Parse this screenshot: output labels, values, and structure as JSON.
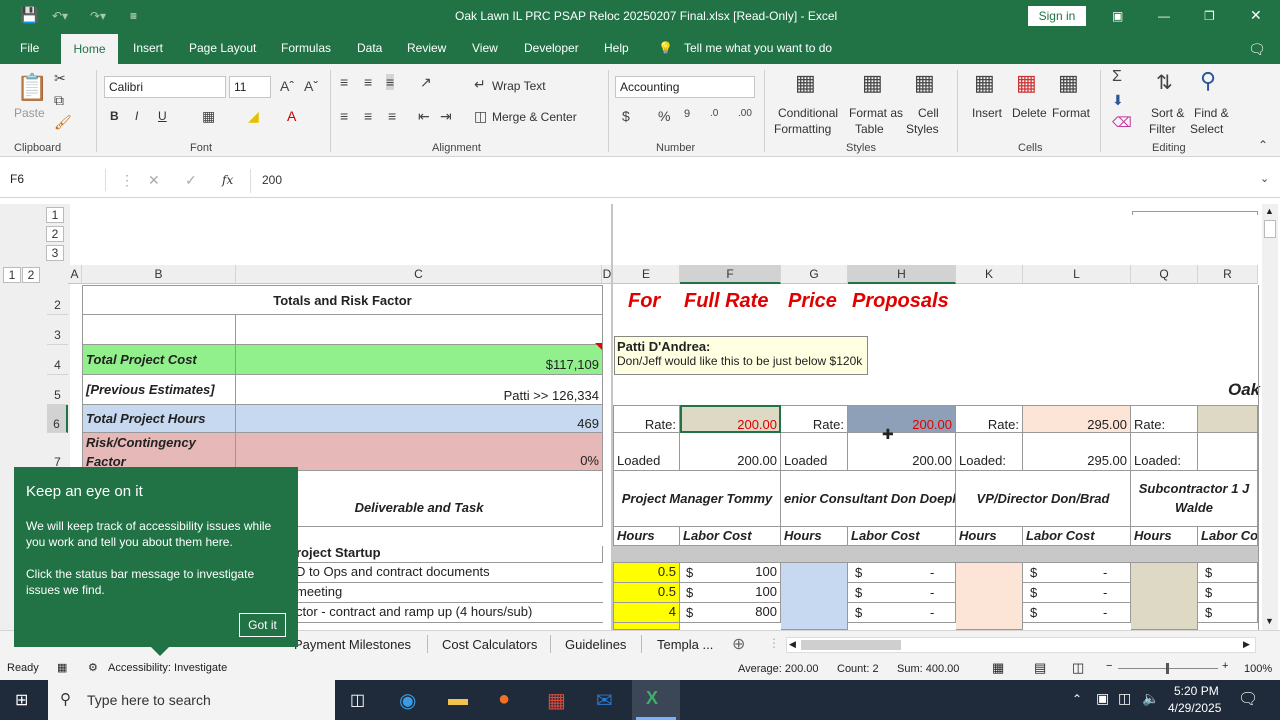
{
  "window": {
    "title": "Oak Lawn IL PRC PSAP Reloc 20250207 Final.xlsx  [Read-Only]  -  Excel",
    "signin": "Sign in"
  },
  "menu": {
    "file": "File",
    "home": "Home",
    "insert": "Insert",
    "page_layout": "Page Layout",
    "formulas": "Formulas",
    "data": "Data",
    "review": "Review",
    "view": "View",
    "developer": "Developer",
    "help": "Help",
    "tell": "Tell me what you want to do"
  },
  "ribbon": {
    "paste": "Paste",
    "clipboard": "Clipboard",
    "font_name": "Calibri",
    "font_size": "11",
    "font": "Font",
    "wrap": "Wrap Text",
    "merge": "Merge & Center",
    "alignment": "Alignment",
    "number_format": "Accounting",
    "number": "Number",
    "conditional": "Conditional",
    "formatting": "Formatting",
    "format_as": "Format as",
    "table": "Table",
    "cell": "Cell",
    "styles_lbl": "Styles",
    "styles": "Styles",
    "insert": "Insert",
    "delete": "Delete",
    "format": "Format",
    "cells": "Cells",
    "sort": "Sort &",
    "filter": "Filter",
    "find": "Find &",
    "select": "Select",
    "editing": "Editing",
    "bold": "B",
    "italic": "I",
    "underline": "U"
  },
  "formula": {
    "name_box": "F6",
    "fx": "fx",
    "value": "200"
  },
  "columns": [
    "A",
    "B",
    "C",
    "D",
    "E",
    "F",
    "G",
    "H",
    "K",
    "L",
    "Q",
    "R"
  ],
  "rows": [
    "2",
    "3",
    "4",
    "5",
    "6",
    "7"
  ],
  "outline": {
    "levels": [
      "1",
      "2",
      "3"
    ],
    "col_levels": [
      "1",
      "2"
    ]
  },
  "cells": {
    "c2": "Totals and Risk Factor",
    "b4": "Total Project Cost",
    "c4": "$117,109",
    "b5": "[Previous Estimates]",
    "c5": "Patti >> 126,334",
    "b6": "Total Project Hours",
    "c6": "469",
    "b7": "Risk/Contingency Factor",
    "c7": "0%",
    "headline": [
      "For",
      "Full Rate",
      "Price",
      "Proposals"
    ],
    "oak": "Oak",
    "rate": "Rate:",
    "f6": "200.00",
    "h6": "200.00",
    "l6": "295.00",
    "loaded": "Loaded",
    "loaded_colon": "Loaded:",
    "f7": "200.00",
    "h7": "200.00",
    "l7": "295.00",
    "deliverable": "Deliverable and Task",
    "pm": "Project Manager Tommy",
    "sc": "enior Consultant Don Doepk",
    "vp": "VP/Director Don/Brad",
    "sub": "Subcontractor 1 J Walde",
    "hours": "Hours",
    "labor": "Labor Cost",
    "labor_cut": "Labor Cos",
    "startup": "roject Startup",
    "task1": "D to Ops and contract documents",
    "task2": "meeting",
    "task3": "ctor - contract and ramp up (4 hours/sub)",
    "e1": "0.5",
    "e2": "0.5",
    "e3": "4",
    "f1": "100",
    "f2": "100",
    "f3": "800",
    "dollar": "$",
    "dash": "-"
  },
  "note": {
    "author": "Patti D'Andrea:",
    "text": "Don/Jeff would like this to be just below $120k"
  },
  "popup": {
    "title": "Keep an eye on it",
    "p1": "We will keep track of accessibility issues while you work and tell you about them here.",
    "p2": "Click the status bar message to investigate issues we find.",
    "button": "Got it"
  },
  "tabs": [
    "Payment Milestones",
    "Cost Calculators",
    "Guidelines",
    "Templa ..."
  ],
  "status": {
    "ready": "Ready",
    "access": "Accessibility: Investigate",
    "average": "Average: 200.00",
    "count": "Count: 2",
    "sum": "Sum: 400.00",
    "zoom": "100%"
  },
  "taskbar": {
    "search": "Type here to search",
    "time": "5:20 PM",
    "date": "4/29/2025"
  },
  "colors": {
    "excel_green": "#217346",
    "cell_green": "#92f08c",
    "cell_blue": "#c6d9f1",
    "cell_pink": "#e6b8b7",
    "yellow": "#ffff00",
    "peach": "#fce4d6",
    "tan": "#ddd9c4",
    "red_text": "#e00000"
  }
}
